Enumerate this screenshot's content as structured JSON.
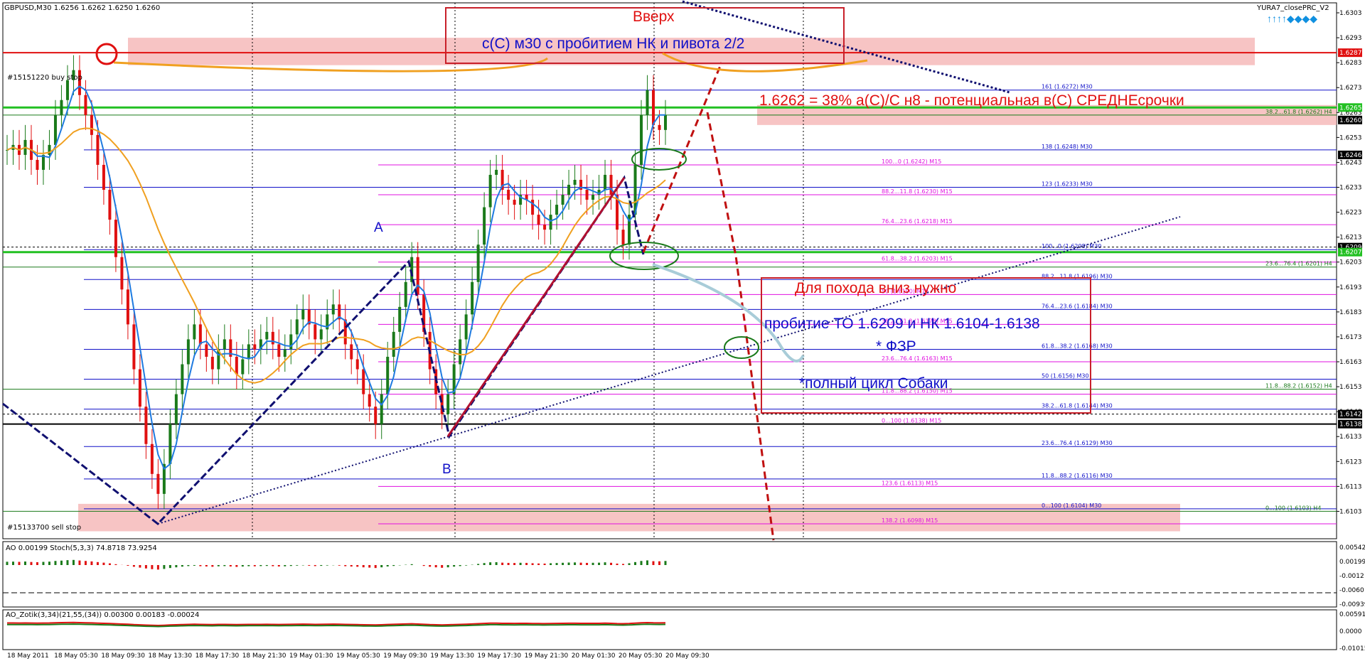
{
  "window": {
    "symbol_header": "GBPUSD,M30  1.6256 1.6262 1.6250 1.6260",
    "indicator_name": "YURA7_closePRC_V2"
  },
  "colors": {
    "bull": "#1a7a1a",
    "bear": "#e01010",
    "annotation_red": "#e01010",
    "annotation_blue": "#1010c8",
    "grid": "#000000",
    "pink_zone": "#f5b5b5"
  },
  "annotations": {
    "box1_title": "Вверх",
    "box1_text": "с(С) м30 с пробитием НК и пивота 2/2",
    "level_note": "1.6262 = 38% а(С)/С н8 - потенциальная в(С) СРЕДНЕсрочки",
    "box2_title": "Для похода вниз нужно",
    "box2_line1": "пробитие ТО 1.6209 и НК 1.6104-1.6138",
    "box2_line2": "* ФЗР",
    "box2_line3": "*полный цикл Собаки",
    "point_a": "A",
    "point_b": "B",
    "buy_stop": "#15151220 buy stop",
    "sell_stop": "#15133700 sell stop"
  },
  "chart_data": {
    "type": "candlestick",
    "title": "GBPUSD,M30",
    "y_range": [
      1.6092,
      1.6307
    ],
    "price_ticks": [
      "1.6303",
      "1.6293",
      "1.6283",
      "1.6273",
      "1.6263",
      "1.6253",
      "1.6243",
      "1.6233",
      "1.6223",
      "1.6213",
      "1.6203",
      "1.6193",
      "1.6183",
      "1.6173",
      "1.6163",
      "1.6153",
      "1.6143",
      "1.6133",
      "1.6123",
      "1.6113",
      "1.6103"
    ],
    "price_tags": [
      {
        "label": "1.6287",
        "color": "#e01010",
        "price": 1.6287
      },
      {
        "label": "1.6265",
        "color": "#22c022",
        "price": 1.6265
      },
      {
        "label": "1.6260",
        "color": "#000000",
        "price": 1.626
      },
      {
        "label": "1.6246",
        "color": "#000000",
        "price": 1.6246
      },
      {
        "label": "1.6209",
        "color": "#000000",
        "price": 1.6209
      },
      {
        "label": "1.6207",
        "color": "#22c022",
        "price": 1.6207
      },
      {
        "label": "1.6142",
        "color": "#000000",
        "price": 1.6142
      },
      {
        "label": "1.6138",
        "color": "#000000",
        "price": 1.6138
      }
    ],
    "time_labels": [
      "18 May 2011",
      "18 May 05:30",
      "18 May 09:30",
      "18 May 13:30",
      "18 May 17:30",
      "18 May 21:30",
      "19 May 01:30",
      "19 May 05:30",
      "19 May 09:30",
      "19 May 13:30",
      "19 May 17:30",
      "19 May 21:30",
      "20 May 01:30",
      "20 May 05:30",
      "20 May 09:30"
    ],
    "fib_levels": [
      {
        "label": "161 (1.6272) M30",
        "price": 1.6272,
        "color": "#1010c8"
      },
      {
        "label": "38.2...61.8 (1.6262) H4",
        "price": 1.6262,
        "color": "#1a7a1a"
      },
      {
        "label": "138 (1.6248) M30",
        "price": 1.6248,
        "color": "#1010c8"
      },
      {
        "label": "100...0 (1.6242) M15",
        "price": 1.6242,
        "color": "#e010e0"
      },
      {
        "label": "123 (1.6233) M30",
        "price": 1.6233,
        "color": "#1010c8"
      },
      {
        "label": "88.2...11.8 (1.6230) M15",
        "price": 1.623,
        "color": "#e010e0"
      },
      {
        "label": "76.4...23.6 (1.6218) M15",
        "price": 1.6218,
        "color": "#e010e0"
      },
      {
        "label": "100...0 (1.6208) M30",
        "price": 1.6208,
        "color": "#1010c8"
      },
      {
        "label": "61.8...38.2 (1.6203) M15",
        "price": 1.6203,
        "color": "#e010e0"
      },
      {
        "label": "23.6...76.4 (1.6201) H4",
        "price": 1.6201,
        "color": "#1a7a1a"
      },
      {
        "label": "88.2...11.8 (1.6196) M30",
        "price": 1.6196,
        "color": "#1010c8"
      },
      {
        "label": "50 (1.6190) M15",
        "price": 1.619,
        "color": "#e010e0"
      },
      {
        "label": "76.4...23.6 (1.6184) M30",
        "price": 1.6184,
        "color": "#1010c8"
      },
      {
        "label": "38.2...61.8 (1.6178) M15",
        "price": 1.6178,
        "color": "#e010e0"
      },
      {
        "label": "61.8...38.2 (1.6168) M30",
        "price": 1.6168,
        "color": "#1010c8"
      },
      {
        "label": "23.6...76.4 (1.6163) M15",
        "price": 1.6163,
        "color": "#e010e0"
      },
      {
        "label": "50 (1.6156) M30",
        "price": 1.6156,
        "color": "#1010c8"
      },
      {
        "label": "11.8...88.2 (1.6152) H4",
        "price": 1.6152,
        "color": "#1a7a1a"
      },
      {
        "label": "11.8...88.2 (1.6150) M15",
        "price": 1.615,
        "color": "#e010e0"
      },
      {
        "label": "38.2...61.8 (1.6144) M30",
        "price": 1.6144,
        "color": "#1010c8"
      },
      {
        "label": "0...100 (1.6138) M15",
        "price": 1.6138,
        "color": "#e010e0"
      },
      {
        "label": "23.6...76.4 (1.6129) M30",
        "price": 1.6129,
        "color": "#1010c8"
      },
      {
        "label": "11.8...88.2 (1.6116) M30",
        "price": 1.6116,
        "color": "#1010c8"
      },
      {
        "label": "123.6 (1.6113) M15",
        "price": 1.6113,
        "color": "#e010e0"
      },
      {
        "label": "0...100 (1.6104) M30",
        "price": 1.6104,
        "color": "#1010c8"
      },
      {
        "label": "0...100 (1.6103) H4",
        "price": 1.6103,
        "color": "#1a7a1a"
      },
      {
        "label": "138.2 (1.6098) M15",
        "price": 1.6098,
        "color": "#e010e0"
      }
    ],
    "candles_close_path": [
      1.6248,
      1.625,
      1.6246,
      1.6252,
      1.6244,
      1.624,
      1.6246,
      1.625,
      1.6262,
      1.6268,
      1.6276,
      1.628,
      1.627,
      1.6262,
      1.6254,
      1.6242,
      1.6232,
      1.622,
      1.6205,
      1.6192,
      1.6178,
      1.616,
      1.6145,
      1.613,
      1.6118,
      1.611,
      1.6122,
      1.6138,
      1.615,
      1.6162,
      1.6172,
      1.6178,
      1.617,
      1.6165,
      1.616,
      1.6168,
      1.6172,
      1.6165,
      1.6158,
      1.6164,
      1.617,
      1.6168,
      1.6172,
      1.6175,
      1.617,
      1.6165,
      1.6168,
      1.6174,
      1.618,
      1.6184,
      1.6178,
      1.6172,
      1.6176,
      1.6182,
      1.6186,
      1.618,
      1.617,
      1.6164,
      1.616,
      1.615,
      1.6145,
      1.6138,
      1.615,
      1.6165,
      1.6175,
      1.6185,
      1.6195,
      1.6205,
      1.619,
      1.6175,
      1.616,
      1.615,
      1.6142,
      1.615,
      1.6162,
      1.6172,
      1.6182,
      1.6195,
      1.621,
      1.6225,
      1.6238,
      1.624,
      1.6232,
      1.6228,
      1.6226,
      1.623,
      1.6228,
      1.6222,
      1.6218,
      1.6216,
      1.6222,
      1.6226,
      1.623,
      1.6234,
      1.6236,
      1.6232,
      1.6228,
      1.623,
      1.6232,
      1.6238,
      1.623,
      1.6216,
      1.621,
      1.6222,
      1.6242,
      1.6262,
      1.6272,
      1.6258,
      1.6256,
      1.6262
    ],
    "ao_label": "AO 0.00199  Stoch(5,3,3) 74.8718 73.9254",
    "ao_ticks": [
      "0.00542",
      "0.00199",
      "-0.0012",
      "-0.0060",
      "-0.00939"
    ],
    "ao_zotik_label": "AO_Zotik(3,34)(21,55,(34)) 0.00300 0.00183 -0.00024",
    "ao_zotik_ticks": [
      "0.00591",
      "0.0000",
      "-0.01015"
    ]
  }
}
